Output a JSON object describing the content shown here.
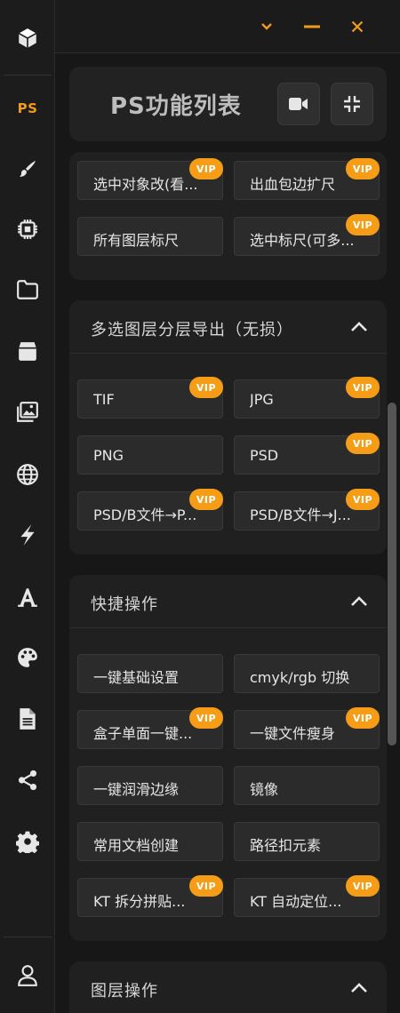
{
  "colors": {
    "accent": "#f29a1a",
    "vip": "#f59d16",
    "background": "#171717",
    "panel": "#202020",
    "button": "#2b2b2b"
  },
  "sidebar": {
    "items": [
      {
        "name": "cube-icon",
        "label": ""
      },
      {
        "name": "ps",
        "label": "PS"
      },
      {
        "name": "brush-icon",
        "label": ""
      },
      {
        "name": "chip-icon",
        "label": ""
      },
      {
        "name": "folder-icon",
        "label": ""
      },
      {
        "name": "box-icon",
        "label": ""
      },
      {
        "name": "images-icon",
        "label": ""
      },
      {
        "name": "globe-icon",
        "label": ""
      },
      {
        "name": "bolt-icon",
        "label": ""
      },
      {
        "name": "font-icon",
        "label": ""
      },
      {
        "name": "palette-icon",
        "label": ""
      },
      {
        "name": "file-icon",
        "label": ""
      },
      {
        "name": "share-icon",
        "label": ""
      },
      {
        "name": "gear-icon",
        "label": ""
      },
      {
        "name": "user-icon",
        "label": ""
      }
    ]
  },
  "window_controls": [
    "chevron-down-icon",
    "minimize-icon",
    "close-icon"
  ],
  "header": {
    "title": "PS功能列表",
    "buttons": [
      "video-icon",
      "compress-icon"
    ]
  },
  "vip_label": "VIP",
  "sections": [
    {
      "title": "",
      "buttons": [
        {
          "label": "选中对象改(看...",
          "vip": true
        },
        {
          "label": "出血包边扩尺",
          "vip": true
        },
        {
          "label": "所有图层标尺",
          "vip": false
        },
        {
          "label": "选中标尺(可多...",
          "vip": true
        }
      ]
    },
    {
      "title": "多选图层分层导出（无损）",
      "buttons": [
        {
          "label": "TIF",
          "vip": true
        },
        {
          "label": "JPG",
          "vip": true
        },
        {
          "label": "PNG",
          "vip": false
        },
        {
          "label": "PSD",
          "vip": true
        },
        {
          "label": "PSD/B文件→P...",
          "vip": true
        },
        {
          "label": "PSD/B文件→J...",
          "vip": true
        }
      ]
    },
    {
      "title": "快捷操作",
      "buttons": [
        {
          "label": "一键基础设置",
          "vip": false
        },
        {
          "label": "cmyk/rgb 切换",
          "vip": false
        },
        {
          "label": "盒子单面一键...",
          "vip": true
        },
        {
          "label": "一键文件瘦身",
          "vip": true
        },
        {
          "label": "一键润滑边缘",
          "vip": false
        },
        {
          "label": "镜像",
          "vip": false
        },
        {
          "label": "常用文档创建",
          "vip": false
        },
        {
          "label": "路径扣元素",
          "vip": false
        },
        {
          "label": "KT 拆分拼贴...",
          "vip": true
        },
        {
          "label": "KT 自动定位...",
          "vip": true
        }
      ]
    },
    {
      "title": "图层操作",
      "buttons": []
    }
  ]
}
